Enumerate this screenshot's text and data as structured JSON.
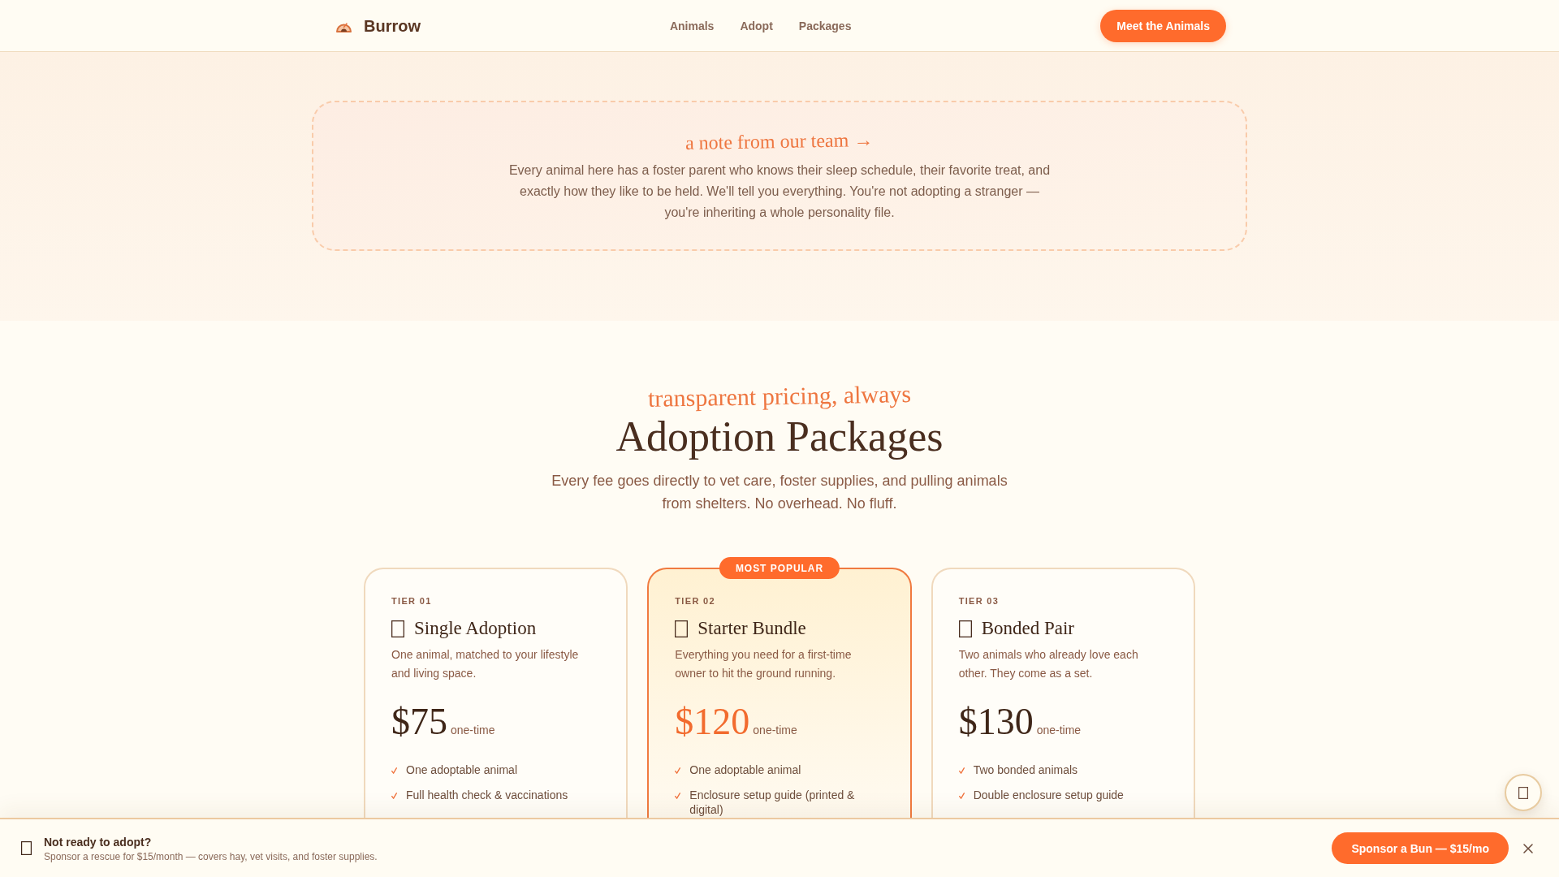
{
  "header": {
    "brand": "Burrow",
    "nav": [
      {
        "label": "Animals"
      },
      {
        "label": "Adopt"
      },
      {
        "label": "Packages"
      }
    ],
    "cta": "Meet the Animals"
  },
  "note": {
    "title": "a note from our team →",
    "text": "Every animal here has a foster parent who knows their sleep schedule, their favorite treat, and exactly how they like to be held. We'll tell you everything. You're not adopting a stranger — you're inheriting a whole personality file."
  },
  "pricing": {
    "kicker": "transparent pricing, always",
    "title": "Adoption Packages",
    "subtitle": "Every fee goes directly to vet care, foster supplies, and pulling animals from shelters. No overhead. No fluff.",
    "tiers": [
      {
        "tier": "TIER 01",
        "name": "Single Adoption",
        "description": "One animal, matched to your lifestyle and living space.",
        "price": "$75",
        "period": "one-time",
        "featured": false,
        "features": [
          "One adoptable animal",
          "Full health check & vaccinations"
        ]
      },
      {
        "badge": "MOST POPULAR",
        "tier": "TIER 02",
        "name": "Starter Bundle",
        "description": "Everything you need for a first-time owner to hit the ground running.",
        "price": "$120",
        "period": "one-time",
        "featured": true,
        "features": [
          "One adoptable animal",
          "Enclosure setup guide (printed & digital)"
        ]
      },
      {
        "tier": "TIER 03",
        "name": "Bonded Pair",
        "description": "Two animals who already love each other. They come as a set.",
        "price": "$130",
        "period": "one-time",
        "featured": false,
        "features": [
          "Two bonded animals",
          "Double enclosure setup guide"
        ]
      }
    ]
  },
  "sponsor_bar": {
    "title": "Not ready to adopt?",
    "text": "Sponsor a rescue for $15/month — covers hay, vet visits, and foster supplies.",
    "button": "Sponsor a Bun — $15/mo"
  }
}
